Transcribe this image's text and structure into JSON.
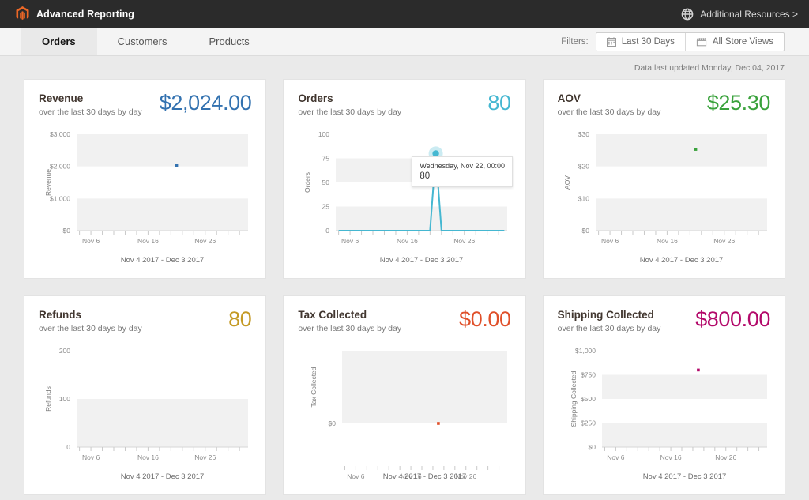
{
  "header": {
    "brand": "Advanced Reporting",
    "logo_icon": "magento-logo-icon",
    "additional_resources": "Additional Resources >",
    "globe_icon": "globe-icon",
    "logo_color": "#ec6726"
  },
  "tabs": [
    {
      "label": "Orders",
      "active": true
    },
    {
      "label": "Customers",
      "active": false
    },
    {
      "label": "Products",
      "active": false
    }
  ],
  "filters": {
    "label": "Filters:",
    "date_button": {
      "label": "Last 30 Days",
      "icon": "calendar-icon"
    },
    "store_button": {
      "label": "All Store Views",
      "icon": "store-icon"
    }
  },
  "updated": "Data last updated Monday, Dec 04, 2017",
  "tooltip": {
    "date": "Wednesday, Nov 22, 00:00",
    "value": "80"
  },
  "chart_data": [
    {
      "type": "scatter",
      "title": "Revenue",
      "subtitle": "over the last 30 days by day",
      "value_label": "$2,024.00",
      "color": "#3372b0",
      "ylabel": "Revenue",
      "xlabel": "Nov 4 2017 - Dec 3 2017",
      "yticks": [
        "$0",
        "$1,000",
        "$2,000",
        "$3,000"
      ],
      "ytick_values": [
        0,
        1000,
        2000,
        3000
      ],
      "ylim": [
        0,
        3000
      ],
      "xticks": [
        "Nov 6",
        "Nov 16",
        "Nov 26"
      ],
      "points": [
        {
          "x": "Nov 22",
          "y": 2024
        }
      ],
      "grid": false,
      "bands": [
        [
          0,
          1000
        ],
        [
          2000,
          3000
        ]
      ]
    },
    {
      "type": "line",
      "title": "Orders",
      "subtitle": "over the last 30 days by day",
      "value_label": "80",
      "color": "#45b7d1",
      "ylabel": "Orders",
      "xlabel": "Nov 4 2017 - Dec 3 2017",
      "yticks": [
        "0",
        "25",
        "50",
        "75",
        "100"
      ],
      "ytick_values": [
        0,
        25,
        50,
        75,
        100
      ],
      "ylim": [
        0,
        100
      ],
      "xticks": [
        "Nov 6",
        "Nov 16",
        "Nov 26"
      ],
      "series": [
        {
          "name": "Orders",
          "values": [
            0,
            0,
            0,
            0,
            0,
            0,
            0,
            0,
            0,
            0,
            0,
            0,
            0,
            0,
            0,
            0,
            0,
            80,
            0,
            0,
            0,
            0,
            0,
            0,
            0,
            0,
            0,
            0,
            0,
            0
          ]
        }
      ],
      "highlight": {
        "x": "Nov 22",
        "y": 80
      },
      "grid": false,
      "bands": [
        [
          0,
          25
        ],
        [
          50,
          75
        ]
      ]
    },
    {
      "type": "scatter",
      "title": "AOV",
      "subtitle": "over the last 30 days by day",
      "value_label": "$25.30",
      "color": "#3aa23c",
      "ylabel": "AOV",
      "xlabel": "Nov 4 2017 - Dec 3 2017",
      "yticks": [
        "$0",
        "$10",
        "$20",
        "$30"
      ],
      "ytick_values": [
        0,
        10,
        20,
        30
      ],
      "ylim": [
        0,
        30
      ],
      "xticks": [
        "Nov 6",
        "Nov 16",
        "Nov 26"
      ],
      "points": [
        {
          "x": "Nov 22",
          "y": 25.3
        }
      ],
      "grid": false,
      "bands": [
        [
          0,
          10
        ],
        [
          20,
          30
        ]
      ]
    },
    {
      "type": "scatter",
      "title": "Refunds",
      "subtitle": "over the last 30 days by day",
      "value_label": "80",
      "color": "#c49a25",
      "ylabel": "Refunds",
      "xlabel": "Nov 4 2017 - Dec 3 2017",
      "yticks": [
        "0",
        "100",
        "200"
      ],
      "ytick_values": [
        0,
        100,
        200
      ],
      "ylim": [
        0,
        200
      ],
      "xticks": [
        "Nov 6",
        "Nov 16",
        "Nov 26"
      ],
      "points": [],
      "grid": false,
      "bands": [
        [
          0,
          100
        ]
      ]
    },
    {
      "type": "scatter",
      "title": "Tax Collected",
      "subtitle": "over the last 30 days by day",
      "value_label": "$0.00",
      "color": "#e0502a",
      "ylabel": "Tax Collected",
      "xlabel": "Nov 4 2017 - Dec 3 2017",
      "yticks": [
        "$0"
      ],
      "ytick_values": [
        0
      ],
      "ylim": [
        0,
        1
      ],
      "xticks": [
        "Nov 6",
        "Nov 16",
        "Nov 26"
      ],
      "points": [
        {
          "x": "Nov 22",
          "y": 0
        }
      ],
      "grid": false,
      "bands": [
        [
          0,
          1
        ]
      ]
    },
    {
      "type": "scatter",
      "title": "Shipping Collected",
      "subtitle": "over the last 30 days by day",
      "value_label": "$800.00",
      "color": "#b3096a",
      "ylabel": "Shipping Collected",
      "xlabel": "Nov 4 2017 - Dec 3 2017",
      "yticks": [
        "$0",
        "$250",
        "$500",
        "$750",
        "$1,000"
      ],
      "ytick_values": [
        0,
        250,
        500,
        750,
        1000
      ],
      "ylim": [
        0,
        1000
      ],
      "xticks": [
        "Nov 6",
        "Nov 16",
        "Nov 26"
      ],
      "points": [
        {
          "x": "Nov 22",
          "y": 800
        }
      ],
      "grid": false,
      "bands": [
        [
          0,
          250
        ],
        [
          500,
          750
        ]
      ]
    }
  ]
}
